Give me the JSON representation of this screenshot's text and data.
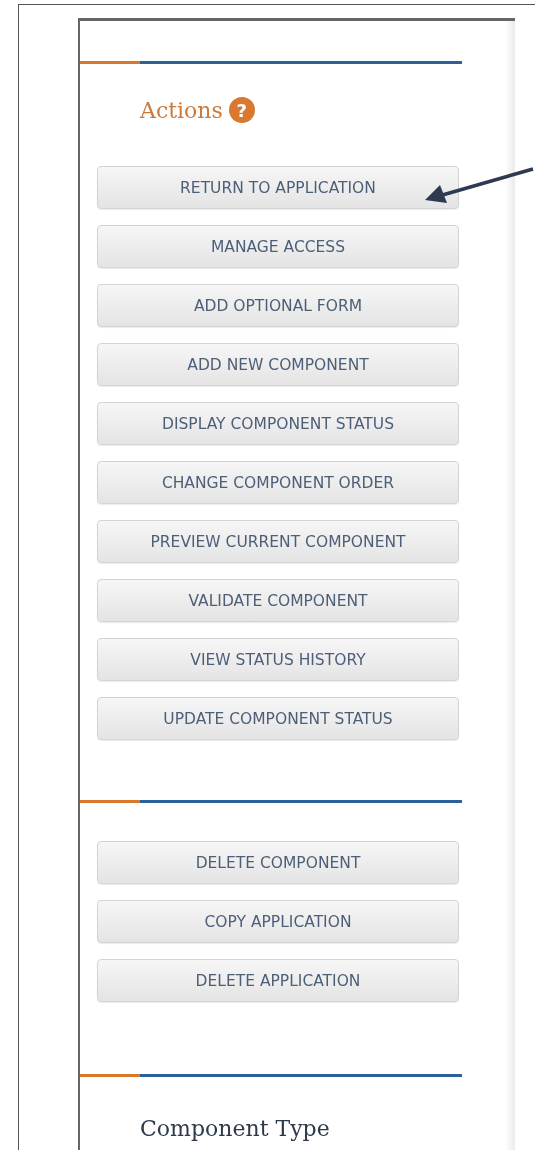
{
  "actions": {
    "title": "Actions",
    "help_mark": "?",
    "buttons": [
      {
        "label": "RETURN TO APPLICATION"
      },
      {
        "label": "MANAGE ACCESS"
      },
      {
        "label": "ADD OPTIONAL FORM"
      },
      {
        "label": "ADD NEW COMPONENT"
      },
      {
        "label": "DISPLAY COMPONENT STATUS"
      },
      {
        "label": "CHANGE COMPONENT ORDER"
      },
      {
        "label": "PREVIEW CURRENT COMPONENT"
      },
      {
        "label": "VALIDATE COMPONENT"
      },
      {
        "label": "VIEW STATUS HISTORY"
      },
      {
        "label": "UPDATE COMPONENT STATUS"
      }
    ]
  },
  "more_actions": {
    "buttons": [
      {
        "label": "DELETE COMPONENT"
      },
      {
        "label": "COPY APPLICATION"
      },
      {
        "label": "DELETE APPLICATION"
      }
    ]
  },
  "component_type": {
    "title": "Component Type"
  }
}
